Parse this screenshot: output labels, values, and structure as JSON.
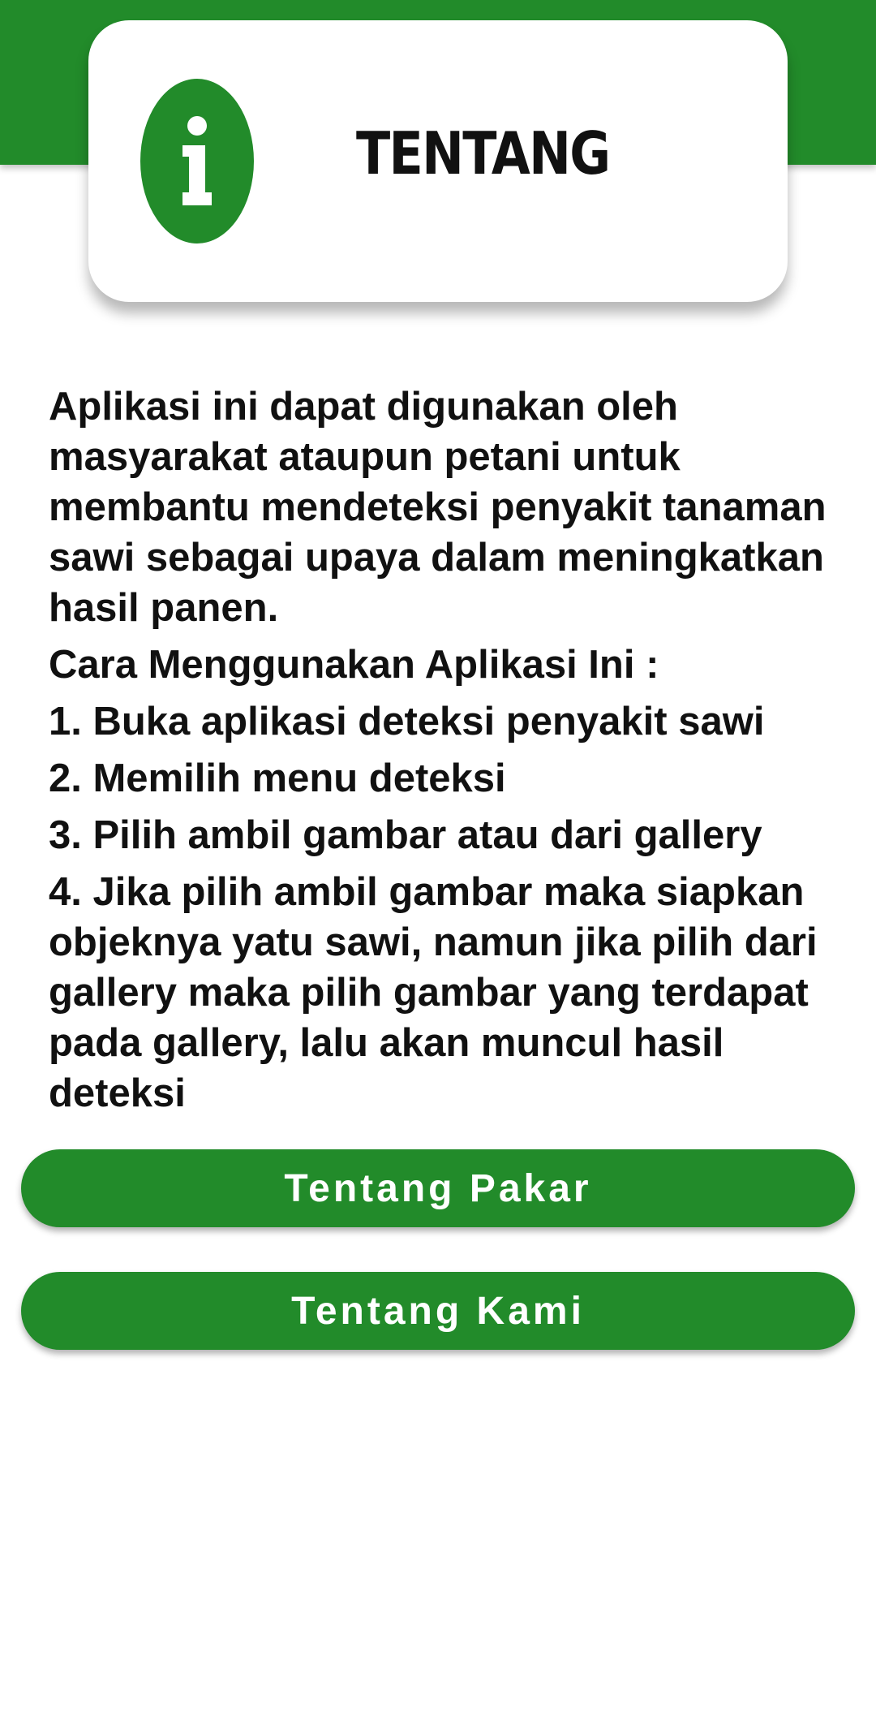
{
  "header": {
    "title": "TENTANG",
    "icon": "info-icon"
  },
  "description": "Aplikasi ini dapat digunakan oleh masyarakat ataupun petani untuk membantu mendeteksi penyakit tanaman sawi sebagai upaya dalam meningkatkan hasil panen.",
  "howto": {
    "heading": "Cara Menggunakan Aplikasi Ini :",
    "steps": [
      "1. Buka aplikasi deteksi penyakit sawi",
      "2. Memilih menu deteksi",
      "3. Pilih ambil gambar atau dari gallery",
      "4. Jika pilih ambil gambar maka siapkan objeknya yatu sawi, namun jika pilih dari gallery maka pilih gambar yang terdapat pada gallery, lalu akan muncul hasil deteksi"
    ]
  },
  "buttons": {
    "pakar": "Tentang Pakar",
    "kami": "Tentang Kami"
  },
  "colors": {
    "primary": "#228b2a",
    "background": "#ffffff",
    "text": "#111111"
  }
}
